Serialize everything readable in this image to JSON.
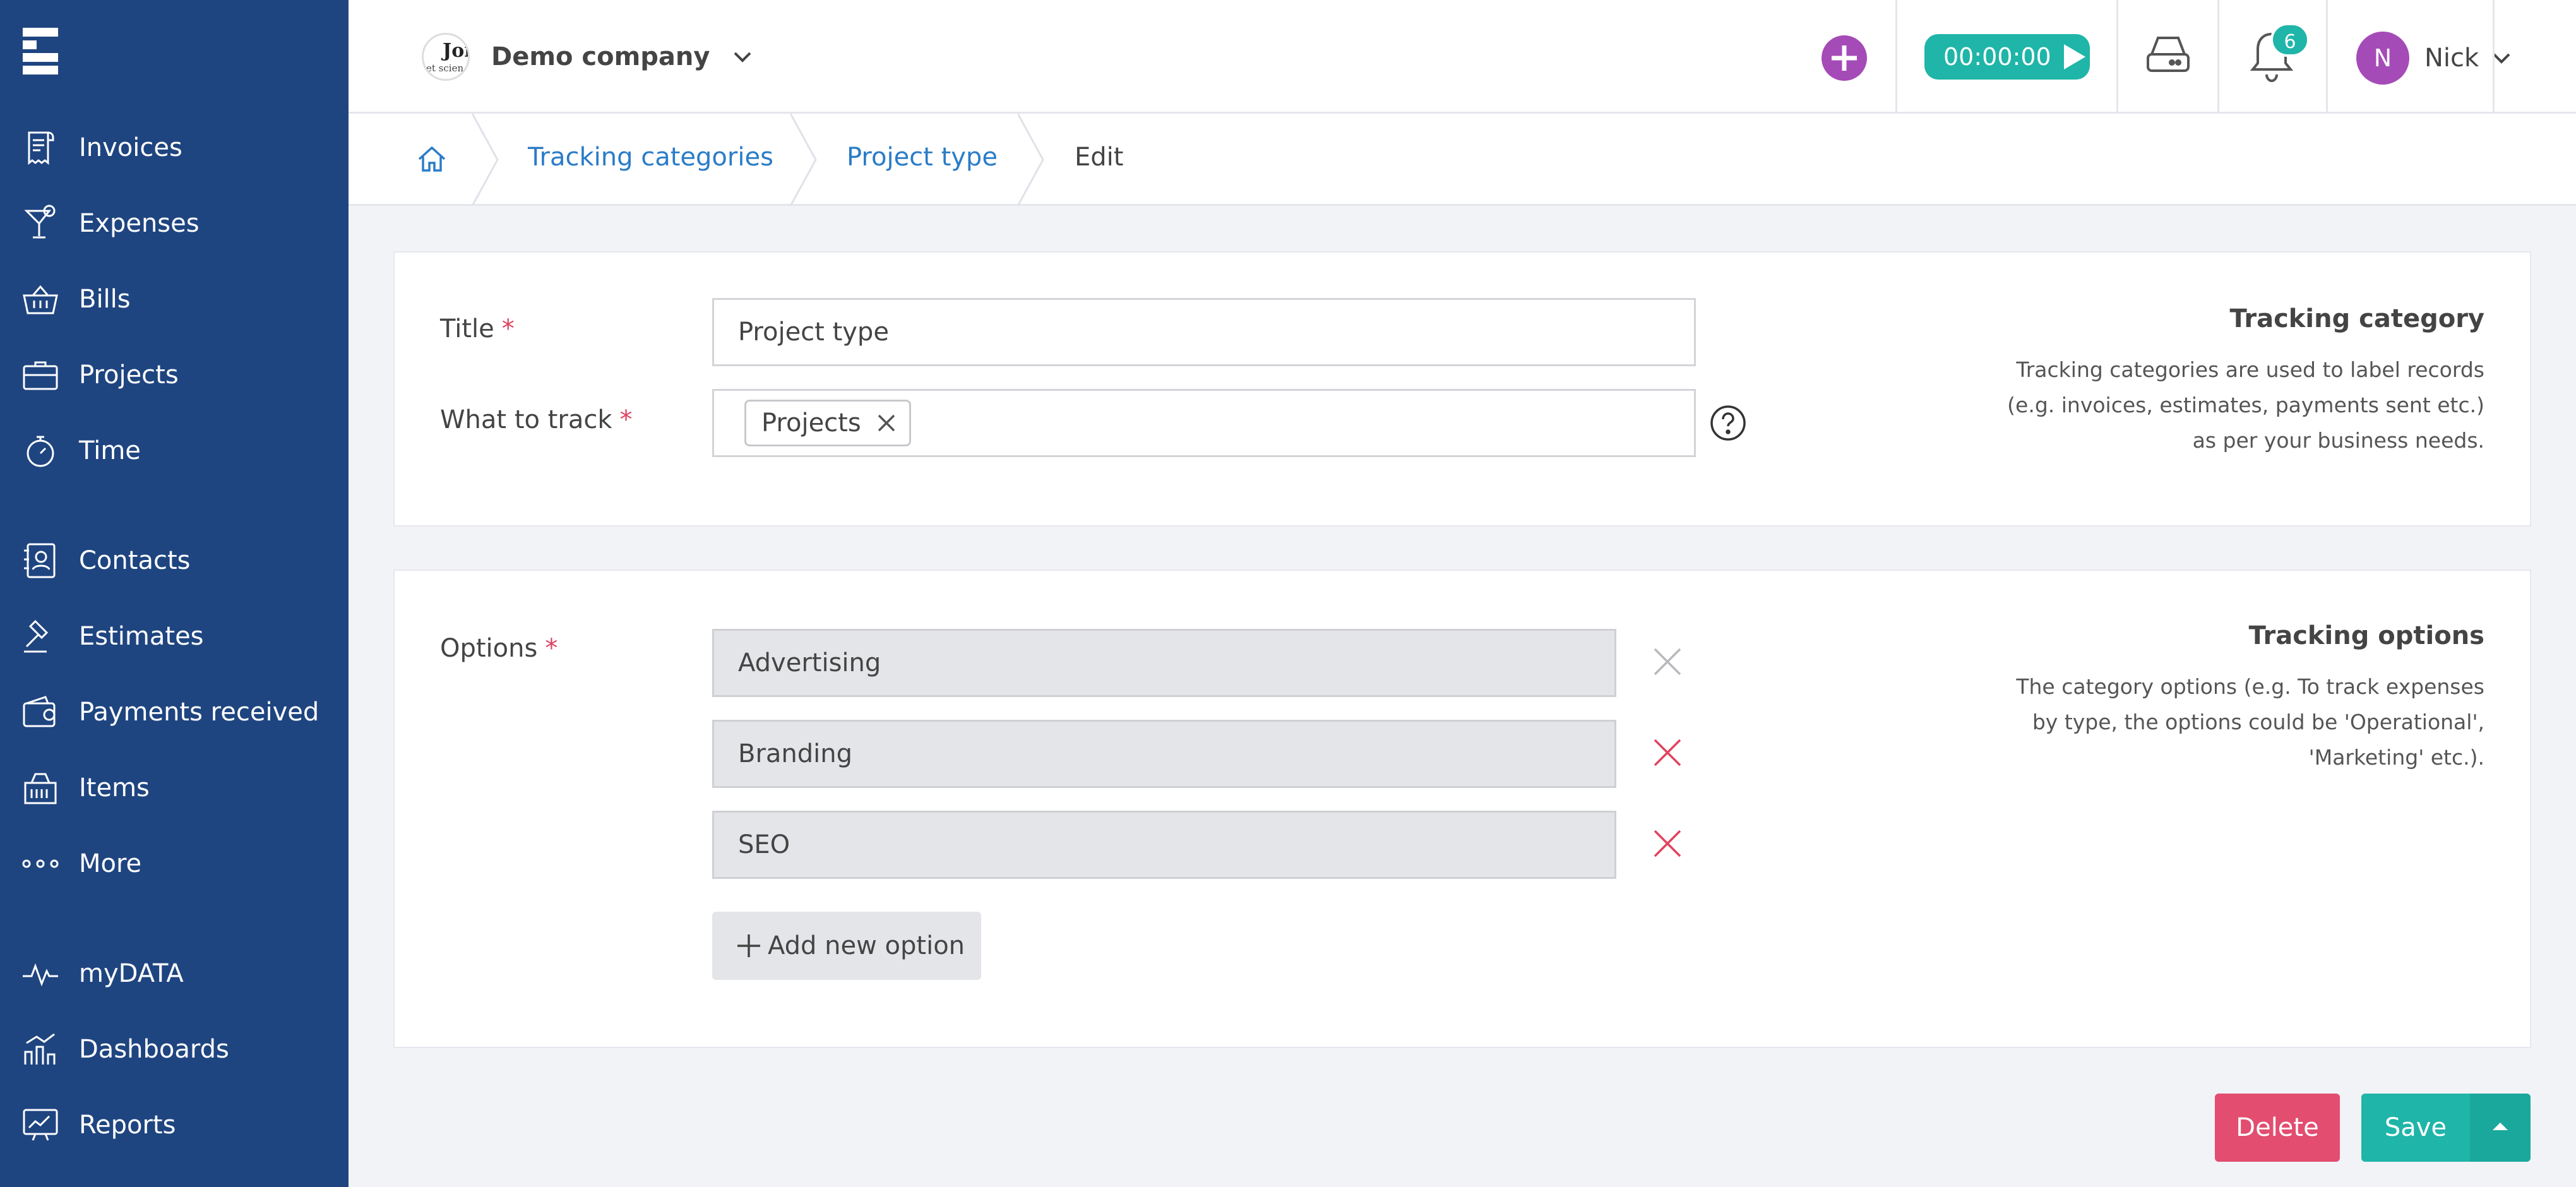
{
  "sidebar": {
    "items": [
      {
        "label": "Invoices",
        "icon": "invoice-icon"
      },
      {
        "label": "Expenses",
        "icon": "cocktail-icon"
      },
      {
        "label": "Bills",
        "icon": "basket-icon"
      },
      {
        "label": "Projects",
        "icon": "briefcase-icon"
      },
      {
        "label": "Time",
        "icon": "stopwatch-icon"
      },
      {
        "label": "Contacts",
        "icon": "contacts-icon"
      },
      {
        "label": "Estimates",
        "icon": "gavel-icon"
      },
      {
        "label": "Payments received",
        "icon": "wallet-icon"
      },
      {
        "label": "Items",
        "icon": "items-icon"
      },
      {
        "label": "More",
        "icon": "more-icon"
      },
      {
        "label": "myDATA",
        "icon": "pulse-icon"
      },
      {
        "label": "Dashboards",
        "icon": "dashboard-icon"
      },
      {
        "label": "Reports",
        "icon": "reports-icon"
      }
    ]
  },
  "topbar": {
    "company_logo_text_1": "Joi",
    "company_logo_text_2": "et scien",
    "company_name": "Demo company",
    "timer": "00:00:00",
    "notifications_count": "6",
    "user_initial": "N",
    "user_name": "Nick"
  },
  "breadcrumb": {
    "items": [
      "Tracking categories",
      "Project type"
    ],
    "current": "Edit"
  },
  "category_card": {
    "title_label": "Title",
    "title_value": "Project type",
    "track_label": "What to track",
    "track_tag": "Projects",
    "side_title": "Tracking category",
    "side_text": [
      "Tracking categories are used to label records",
      "(e.g. invoices, estimates, payments sent etc.)",
      "as per your business needs."
    ]
  },
  "options_card": {
    "label": "Options",
    "options": [
      "Advertising",
      "Branding",
      "SEO"
    ],
    "add_label": "Add new option",
    "side_title": "Tracking options",
    "side_text": [
      "The category options (e.g. To track expenses",
      "by type, the options could be 'Operational',",
      "'Marketing' etc.)."
    ]
  },
  "actions": {
    "delete_label": "Delete",
    "save_label": "Save"
  },
  "colors": {
    "sidebar": "#1f4580",
    "accent_teal": "#1fb5a8",
    "accent_purple": "#a54bb7",
    "danger": "#e24d70",
    "link": "#2a7cc7",
    "required": "#e0435f"
  }
}
